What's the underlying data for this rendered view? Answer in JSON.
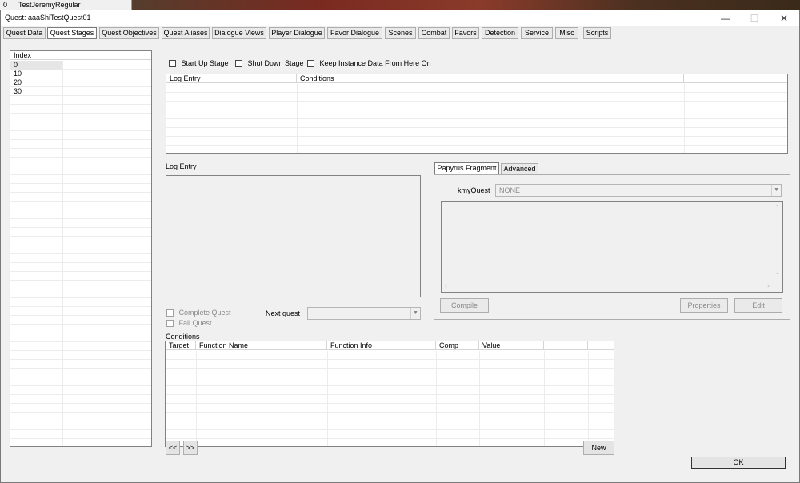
{
  "background_row": {
    "index": "0",
    "name": "TestJeremyRegular"
  },
  "window": {
    "title": "Quest: aaaShiTestQuest01",
    "minimize": "—",
    "maximize": "☐",
    "close": "✕"
  },
  "tabs": [
    {
      "label": "Quest Data"
    },
    {
      "label": "Quest Stages"
    },
    {
      "label": "Quest Objectives"
    },
    {
      "label": "Quest Aliases"
    },
    {
      "label": "Dialogue Views"
    },
    {
      "label": "Player Dialogue"
    },
    {
      "label": "Favor Dialogue"
    },
    {
      "label": "Scenes"
    },
    {
      "label": "Combat"
    },
    {
      "label": "Favors"
    },
    {
      "label": "Detection"
    },
    {
      "label": "Service"
    },
    {
      "label": "Misc"
    },
    {
      "label": "Scripts"
    }
  ],
  "active_tab": "Quest Stages",
  "stages": {
    "header": "Index",
    "items": [
      "0",
      "10",
      "20",
      "30"
    ]
  },
  "options": {
    "start_up_stage": "Start Up Stage",
    "shut_down_stage": "Shut Down Stage",
    "keep_instance": "Keep Instance Data From Here On"
  },
  "log_table": {
    "columns": [
      "Log Entry",
      "Conditions"
    ]
  },
  "log_entry_label": "Log Entry",
  "complete_quest": "Complete Quest",
  "fail_quest": "Fail Quest",
  "next_quest_label": "Next quest",
  "conditions_label": "Conditions",
  "conditions_table": {
    "columns": [
      "Target",
      "Function Name",
      "Function Info",
      "Comp",
      "Value"
    ]
  },
  "nav": {
    "prev": "<<",
    "next": ">>"
  },
  "new_button": "New",
  "ok_button": "OK",
  "fragment": {
    "tabs": [
      "Papyrus Fragment",
      "Advanced"
    ],
    "kmyquest_label": "kmyQuest",
    "kmyquest_value": "NONE",
    "compile": "Compile",
    "properties": "Properties",
    "edit": "Edit"
  }
}
